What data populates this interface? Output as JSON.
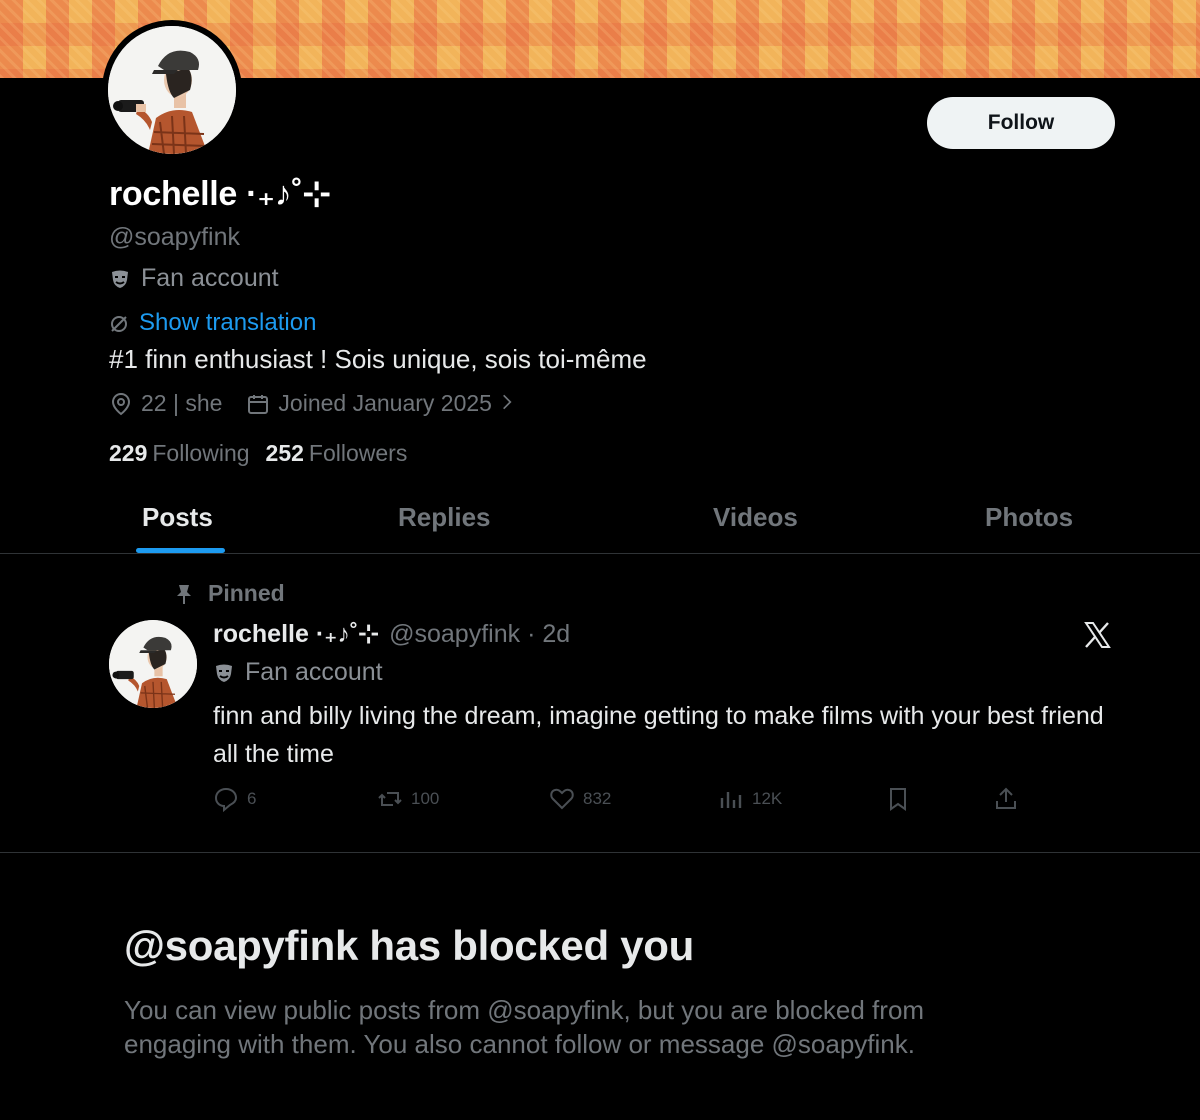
{
  "profile": {
    "name": "rochelle ·₊♪˚⊹",
    "handle": "@soapyfink",
    "category": "Fan account",
    "translate_link": "Show translation",
    "bio": "#1 finn enthusiast ! Sois unique, sois toi-même",
    "location": "22 | she",
    "joined": "Joined January 2025",
    "following_count": "229",
    "following_label": "Following",
    "followers_count": "252",
    "followers_label": "Followers",
    "follow_button": "Follow"
  },
  "tabs": [
    {
      "label": "Posts",
      "active": true
    },
    {
      "label": "Replies",
      "active": false
    },
    {
      "label": "Videos",
      "active": false
    },
    {
      "label": "Photos",
      "active": false
    }
  ],
  "post": {
    "pinned_label": "Pinned",
    "author_name": "rochelle ·₊♪˚⊹",
    "author_meta": "@soapyfink · 2d",
    "category": "Fan account",
    "text": "finn and billy living the dream, imagine getting to make films with your best friend all the time",
    "replies": "6",
    "reposts": "100",
    "likes": "832",
    "views": "12K"
  },
  "blocked": {
    "title": "@soapyfink has blocked you",
    "message": "You can view public posts from @soapyfink, but you are blocked from engaging with them. You also cannot follow or message @soapyfink."
  },
  "colors": {
    "background": "#000000",
    "accent": "#1d9bf0",
    "muted": "#71767b",
    "text": "#e7e9ea",
    "banner": "#f2b45a"
  }
}
